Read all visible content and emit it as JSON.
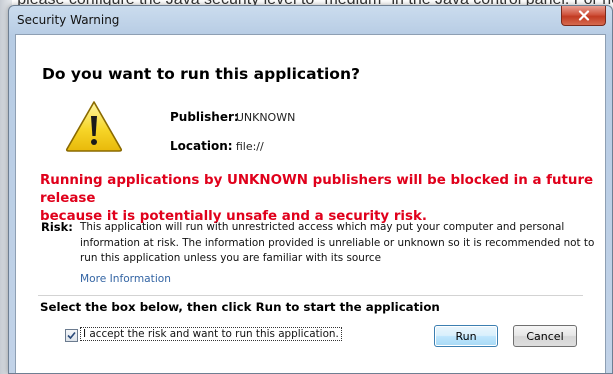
{
  "background": {
    "partial_text": "ly, please configure the Java security level to \"medium\" in the Java control panel. For help"
  },
  "window": {
    "title": "Security Warning"
  },
  "dialog": {
    "question": "Do you want to run this application?",
    "publisher_label": "Publisher:",
    "publisher_value": "UNKNOWN",
    "location_label": "Location:",
    "location_value": "file://",
    "warning_line1": "Running applications by UNKNOWN publishers will be blocked in a future release",
    "warning_line2": "because it is potentially unsafe and a security risk.",
    "risk_label": "Risk:",
    "risk_line1": "This application will run with unrestricted access which may put your computer and personal",
    "risk_line2": "information at risk. The information provided is unreliable or unknown so it is recommended not to",
    "risk_line3": "run this application unless you are familiar with its source",
    "more_info": "More Information",
    "select_hint": "Select the box below, then click Run to start the application",
    "checkbox_label": "I accept the risk and want to run this application.",
    "checkbox_checked": true,
    "run_label": "Run",
    "cancel_label": "Cancel"
  },
  "icons": {
    "warning": "warning-triangle-icon",
    "close": "close-x-icon",
    "check": "checkmark-icon"
  },
  "colors": {
    "warning_text": "#e0001b",
    "link": "#3465a4",
    "close_button": "#c23b22"
  }
}
